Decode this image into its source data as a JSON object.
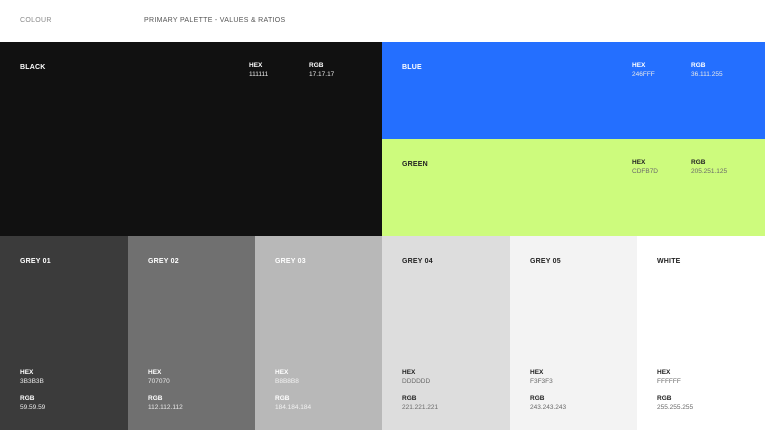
{
  "header": {
    "section": "COLOUR",
    "title": "PRIMARY PALETTE - VALUES & RATIOS"
  },
  "labels": {
    "hex": "HEX",
    "rgb": "RGB"
  },
  "swatches": {
    "black": {
      "name": "BLACK",
      "hex": "111111",
      "rgb": "17.17.17",
      "color": "#111111"
    },
    "blue": {
      "name": "BLUE",
      "hex": "246FFF",
      "rgb": "36.111.255",
      "color": "#246FFF"
    },
    "green": {
      "name": "GREEN",
      "hex": "CDFB7D",
      "rgb": "205.251.125",
      "color": "#CDFB7D"
    },
    "grey01": {
      "name": "GREY 01",
      "hex": "3B3B3B",
      "rgb": "59.59.59",
      "color": "#3B3B3B"
    },
    "grey02": {
      "name": "GREY 02",
      "hex": "707070",
      "rgb": "112.112.112",
      "color": "#707070"
    },
    "grey03": {
      "name": "GREY 03",
      "hex": "B8B8B8",
      "rgb": "184.184.184",
      "color": "#B8B8B8"
    },
    "grey04": {
      "name": "GREY 04",
      "hex": "DDDDDD",
      "rgb": "221.221.221",
      "color": "#DDDDDD"
    },
    "grey05": {
      "name": "GREY 05",
      "hex": "F3F3F3",
      "rgb": "243.243.243",
      "color": "#F3F3F3"
    },
    "white": {
      "name": "WHITE",
      "hex": "FFFFFF",
      "rgb": "255.255.255",
      "color": "#FFFFFF"
    }
  }
}
